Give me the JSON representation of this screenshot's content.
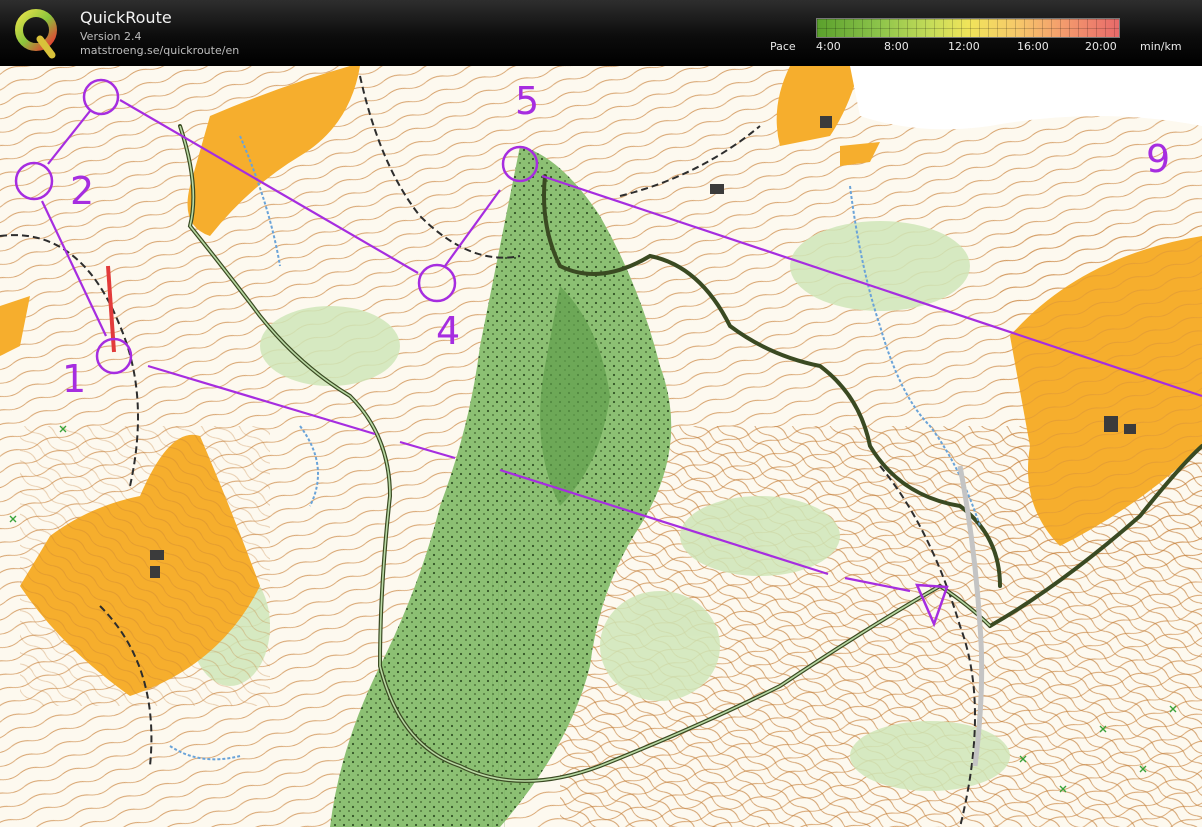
{
  "app": {
    "title": "QuickRoute",
    "version": "Version 2.4",
    "url": "matstroeng.se/quickroute/en"
  },
  "pace_legend": {
    "label": "Pace",
    "ticks": [
      "4:00",
      "8:00",
      "12:00",
      "16:00",
      "20:00"
    ],
    "unit": "min/km",
    "colors": [
      "#5aa02c",
      "#c6dc59",
      "#f0e45a",
      "#f6c96a",
      "#e86a6a"
    ]
  },
  "map": {
    "course_color": "#a62de0",
    "controls": [
      {
        "id": "control-1",
        "label": "1"
      },
      {
        "id": "control-2",
        "label": "2"
      },
      {
        "id": "control-4",
        "label": "4"
      },
      {
        "id": "control-5",
        "label": "5"
      },
      {
        "id": "control-9",
        "label": "9"
      }
    ]
  }
}
